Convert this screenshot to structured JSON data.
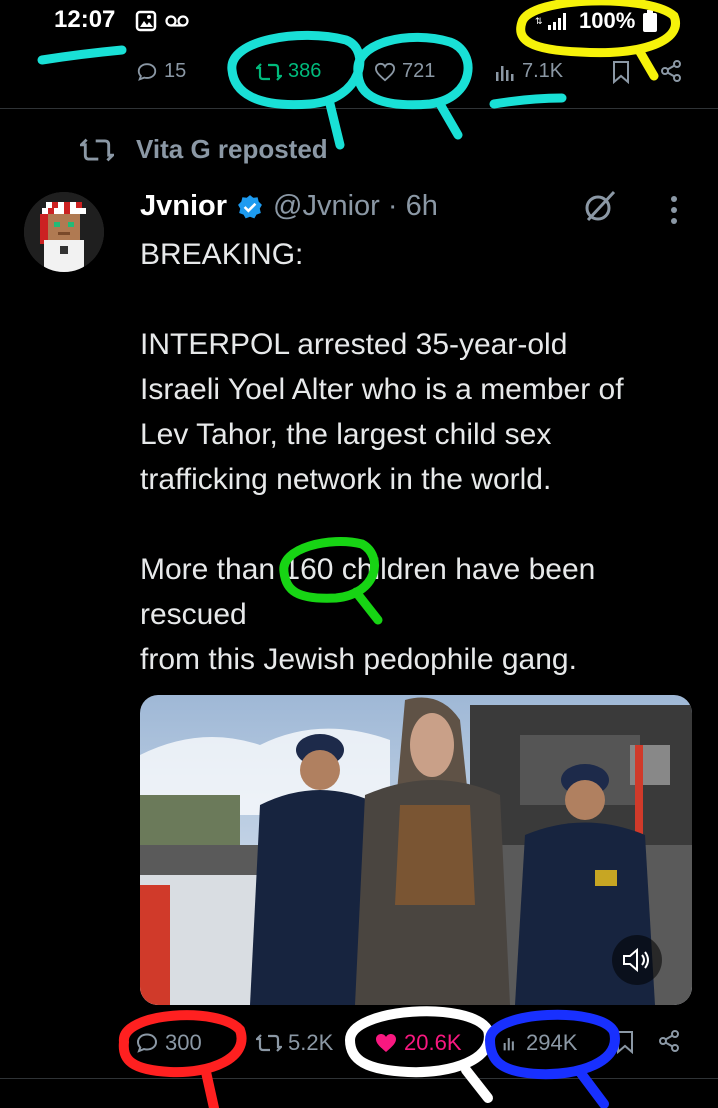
{
  "status_bar": {
    "time": "12:07",
    "battery": "100%"
  },
  "prev_tweet_actions": {
    "replies": "15",
    "reposts": "386",
    "likes": "721",
    "views": "7.1K"
  },
  "repost_line": {
    "text": "Vita G reposted"
  },
  "tweet": {
    "author_name": "Jvnior",
    "handle_time": "@Jvnior · 6h",
    "text_lines": [
      "BREAKING:",
      "INTERPOL arrested 35-year-old",
      "Israeli Yoel Alter who is a member of",
      "Lev Tahor, the largest child sex",
      "trafficking network in the world.",
      "More than 160 children have been",
      "rescued",
      "from this Jewish pedophile gang."
    ],
    "actions": {
      "replies": "300",
      "reposts": "5.2K",
      "likes": "20.6K",
      "views": "294K"
    }
  },
  "colors": {
    "accent_green": "#00ba7c",
    "like_pink": "#f91880",
    "verified_blue": "#1d9bf0",
    "annotation_cyan": "#19e0d6",
    "annotation_yellow": "#f6f20a",
    "annotation_green": "#17d414",
    "annotation_red": "#ff2020",
    "annotation_white": "#ffffff",
    "annotation_blue": "#1830ff"
  }
}
